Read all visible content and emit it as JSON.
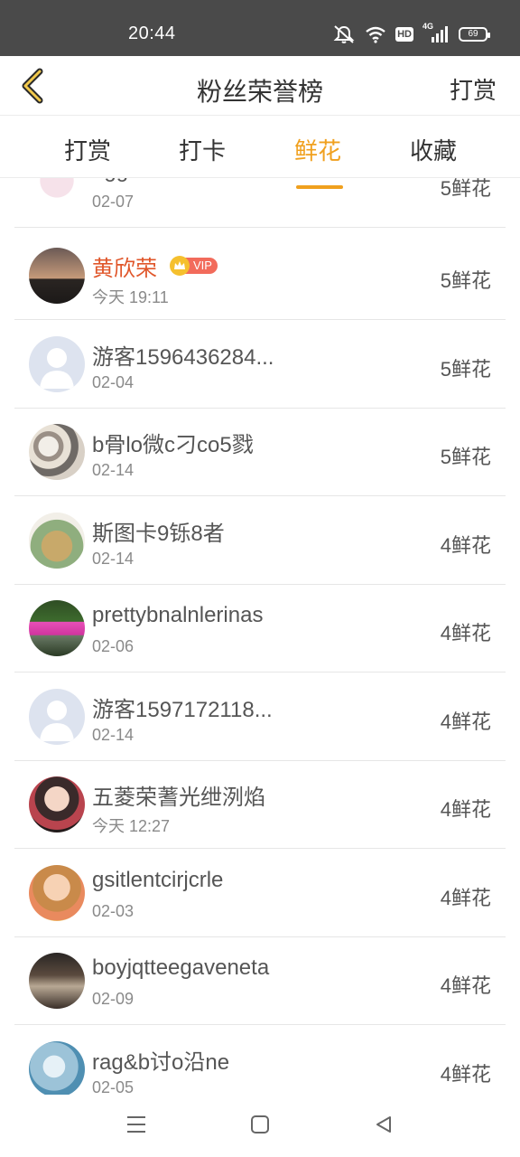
{
  "status_bar": {
    "time": "20:44",
    "hd": "HD",
    "network": "4G",
    "battery": "69",
    "icons": [
      "mute-icon",
      "wifi-icon",
      "hd-icon",
      "signal-4g-icon",
      "battery-icon"
    ]
  },
  "header": {
    "title": "粉丝荣誉榜",
    "right_action": "打赏",
    "back_icon": "chevron-left-icon",
    "accent_color": "#f0a01e"
  },
  "tabs": [
    {
      "label": "打赏",
      "active": false
    },
    {
      "label": "打卡",
      "active": false
    },
    {
      "label": "鲜花",
      "active": true
    },
    {
      "label": "收藏",
      "active": false
    }
  ],
  "list": [
    {
      "name": "aggiaraxsdtralla",
      "date": "02-07",
      "count": "5鲜花",
      "avatar": "cartoon",
      "highlight": false
    },
    {
      "name": "黄欣荣",
      "date": "今天 19:11",
      "count": "5鲜花",
      "avatar": "sunset",
      "highlight": true,
      "vip": "VIP"
    },
    {
      "name": "游客1596436284...",
      "date": "02-04",
      "count": "5鲜花",
      "avatar": "default",
      "highlight": false
    },
    {
      "name": "b骨lo微c刁co5戮",
      "date": "02-14",
      "count": "5鲜花",
      "avatar": "shells",
      "highlight": false
    },
    {
      "name": "斯图卡9铄8者",
      "date": "02-14",
      "count": "4鲜花",
      "avatar": "money",
      "highlight": false
    },
    {
      "name": "prettybnalnlerinas",
      "date": "02-06",
      "count": "4鲜花",
      "avatar": "car",
      "highlight": false
    },
    {
      "name": "游客1597172118...",
      "date": "02-14",
      "count": "4鲜花",
      "avatar": "default",
      "highlight": false
    },
    {
      "name": "五菱荣蓍光绁洌焰",
      "date": "今天 12:27",
      "count": "4鲜花",
      "avatar": "girl1",
      "highlight": false
    },
    {
      "name": "gsitlentcirjcrle",
      "date": "02-03",
      "count": "4鲜花",
      "avatar": "girl2",
      "highlight": false
    },
    {
      "name": "boyjqtteegaveneta",
      "date": "02-09",
      "count": "4鲜花",
      "avatar": "room",
      "highlight": false
    },
    {
      "name": "rag&b讨o沿ne",
      "date": "02-05",
      "count": "4鲜花",
      "avatar": "blue",
      "highlight": false
    }
  ],
  "nav_bar": {
    "icons": [
      "menu-icon",
      "home-icon",
      "back-triangle-icon"
    ]
  }
}
